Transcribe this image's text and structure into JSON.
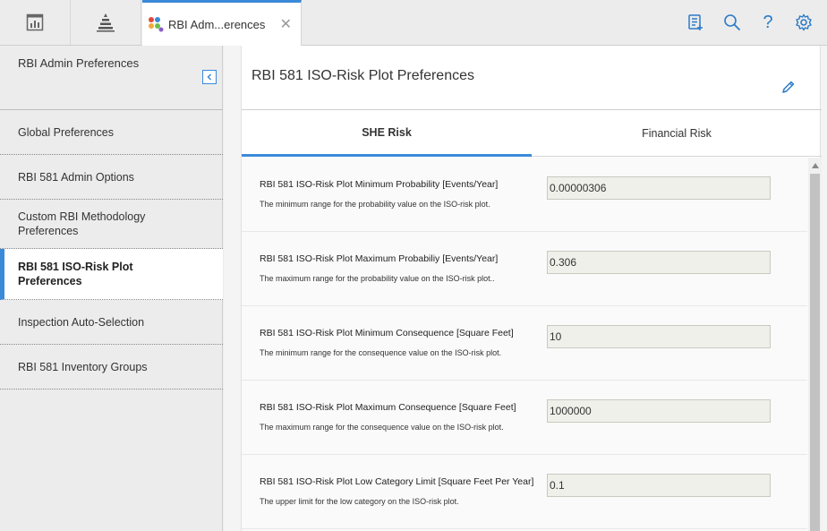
{
  "topbar": {
    "tab_label": "RBI Adm...erences",
    "tab_close": "✕",
    "help_glyph": "?"
  },
  "sidebar": {
    "title": "RBI Admin Preferences",
    "items": [
      {
        "label": "Global Preferences"
      },
      {
        "label": "RBI 581 Admin Options"
      },
      {
        "label": "Custom RBI Methodology Preferences"
      },
      {
        "label": "RBI 581 ISO-Risk Plot Preferences",
        "active": true
      },
      {
        "label": "Inspection Auto-Selection"
      },
      {
        "label": "RBI 581 Inventory Groups"
      }
    ]
  },
  "main": {
    "title": "RBI 581 ISO-Risk Plot Preferences",
    "tabs": [
      {
        "label": "SHE Risk",
        "active": true
      },
      {
        "label": "Financial Risk"
      }
    ],
    "rows": [
      {
        "label": "RBI 581 ISO-Risk Plot Minimum Probability [Events/Year]",
        "description": "The minimum range for the probability value on the ISO-risk plot.",
        "value": "0.00000306"
      },
      {
        "label": "RBI 581 ISO-Risk Plot Maximum Probabiliy [Events/Year]",
        "description": "The maximum range for the probability value on the ISO-risk plot..",
        "value": "0.306"
      },
      {
        "label": "RBI 581 ISO-Risk Plot Minimum Consequence [Square Feet]",
        "description": "The minimum range for the consequence value on the ISO-risk plot.",
        "value": "10"
      },
      {
        "label": "RBI 581 ISO-Risk Plot Maximum Consequence [Square Feet]",
        "description": "The maximum range for the consequence value on the ISO-risk plot.",
        "value": "1000000"
      },
      {
        "label": "RBI 581 ISO-Risk Plot Low Category Limit [Square Feet Per Year]",
        "description": "The upper limit for the low category on the ISO-risk plot.",
        "value": "0.1"
      }
    ]
  },
  "colors": {
    "accent": "#3a8ad8",
    "icon_blue": "#2b7bc8"
  },
  "icons": [
    "dashboard-icon",
    "hierarchy-icon",
    "app-logo-icon",
    "close-icon",
    "task-list-icon",
    "search-icon",
    "help-icon",
    "settings-icon",
    "collapse-icon",
    "edit-icon"
  ]
}
